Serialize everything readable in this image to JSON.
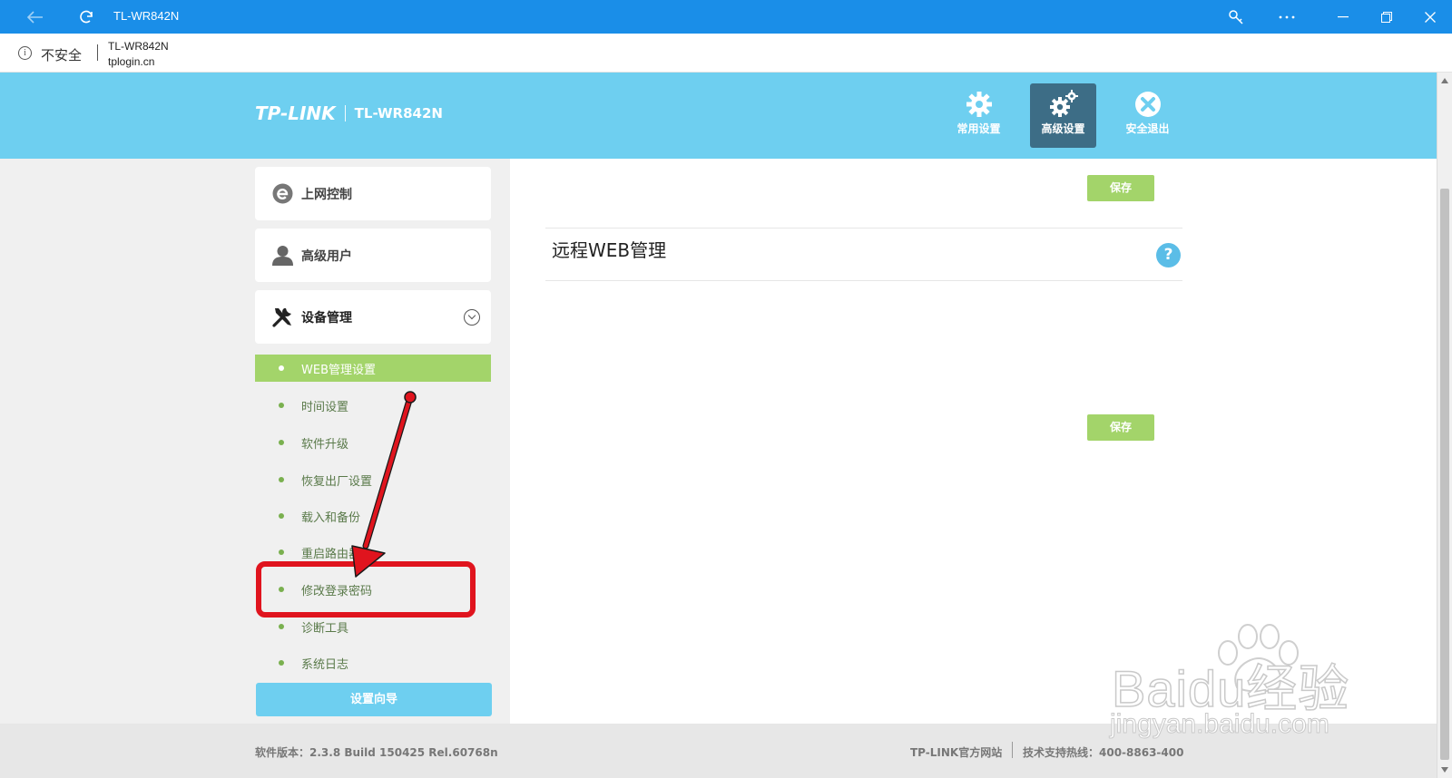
{
  "browser": {
    "tab_title": "TL-WR842N",
    "security_label": "不安全",
    "page_title": "TL-WR842N",
    "url": "tplogin.cn"
  },
  "header": {
    "brand": "TP-LINK",
    "model": "TL-WR842N",
    "nav": [
      {
        "label": "常用设置",
        "icon": "gear-icon",
        "active": false
      },
      {
        "label": "高级设置",
        "icon": "gears-icon",
        "active": true
      },
      {
        "label": "安全退出",
        "icon": "close-circle-icon",
        "active": false
      }
    ]
  },
  "sidebar": {
    "sections": [
      {
        "label": "上网控制",
        "icon": "internet-e-icon"
      },
      {
        "label": "高级用户",
        "icon": "user-icon"
      },
      {
        "label": "设备管理",
        "icon": "tools-icon",
        "expanded": true
      }
    ],
    "sub_items": [
      {
        "label": "WEB管理设置",
        "active": true
      },
      {
        "label": "时间设置",
        "active": false
      },
      {
        "label": "软件升级",
        "active": false
      },
      {
        "label": "恢复出厂设置",
        "active": false
      },
      {
        "label": "载入和备份",
        "active": false
      },
      {
        "label": "重启路由器",
        "active": false
      },
      {
        "label": "修改登录密码",
        "active": false
      },
      {
        "label": "诊断工具",
        "active": false
      },
      {
        "label": "系统日志",
        "active": false
      }
    ],
    "wizard_label": "设置向导"
  },
  "main": {
    "save_label": "保存",
    "section_title": "远程WEB管理",
    "help_label": "?"
  },
  "footer": {
    "version": "软件版本：2.3.8 Build 150425 Rel.60768n",
    "official_site": "TP-LINK官方网站",
    "hotline": "技术支持热线：400-8863-400"
  },
  "watermark": {
    "brand": "Baidu经验",
    "url": "jingyan.baidu.com"
  },
  "colors": {
    "titlebar": "#1a8ee8",
    "header": "#6ecff0",
    "active_nav": "#3d6d86",
    "green": "#a3d46a",
    "annotation_red": "#e0141e"
  }
}
